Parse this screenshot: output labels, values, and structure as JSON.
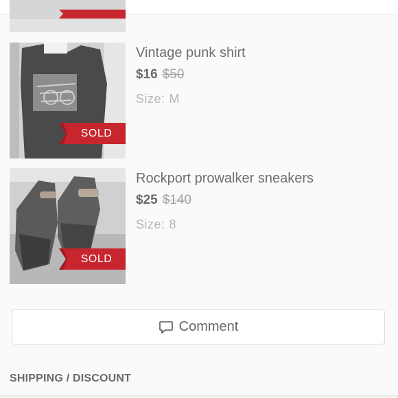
{
  "colors": {
    "sold_ribbon": "#c8262e",
    "background": "#fafafa",
    "text": "#6e6e6e",
    "muted": "#b6b6b6"
  },
  "items": [
    {
      "title": "Vintage punk shirt",
      "price": "$16",
      "original_price": "$50",
      "size_label": "Size:",
      "size_value": "M",
      "badge": "SOLD",
      "image": "black-tshirt-photo"
    },
    {
      "title": "Rockport prowalker sneakers",
      "price": "$25",
      "original_price": "$140",
      "size_label": "Size:",
      "size_value": "8",
      "badge": "SOLD",
      "image": "sneakers-photo"
    }
  ],
  "comment": {
    "label": "Comment",
    "icon": "speech-bubble-icon"
  },
  "shipping_section": {
    "title": "SHIPPING / DISCOUNT"
  }
}
